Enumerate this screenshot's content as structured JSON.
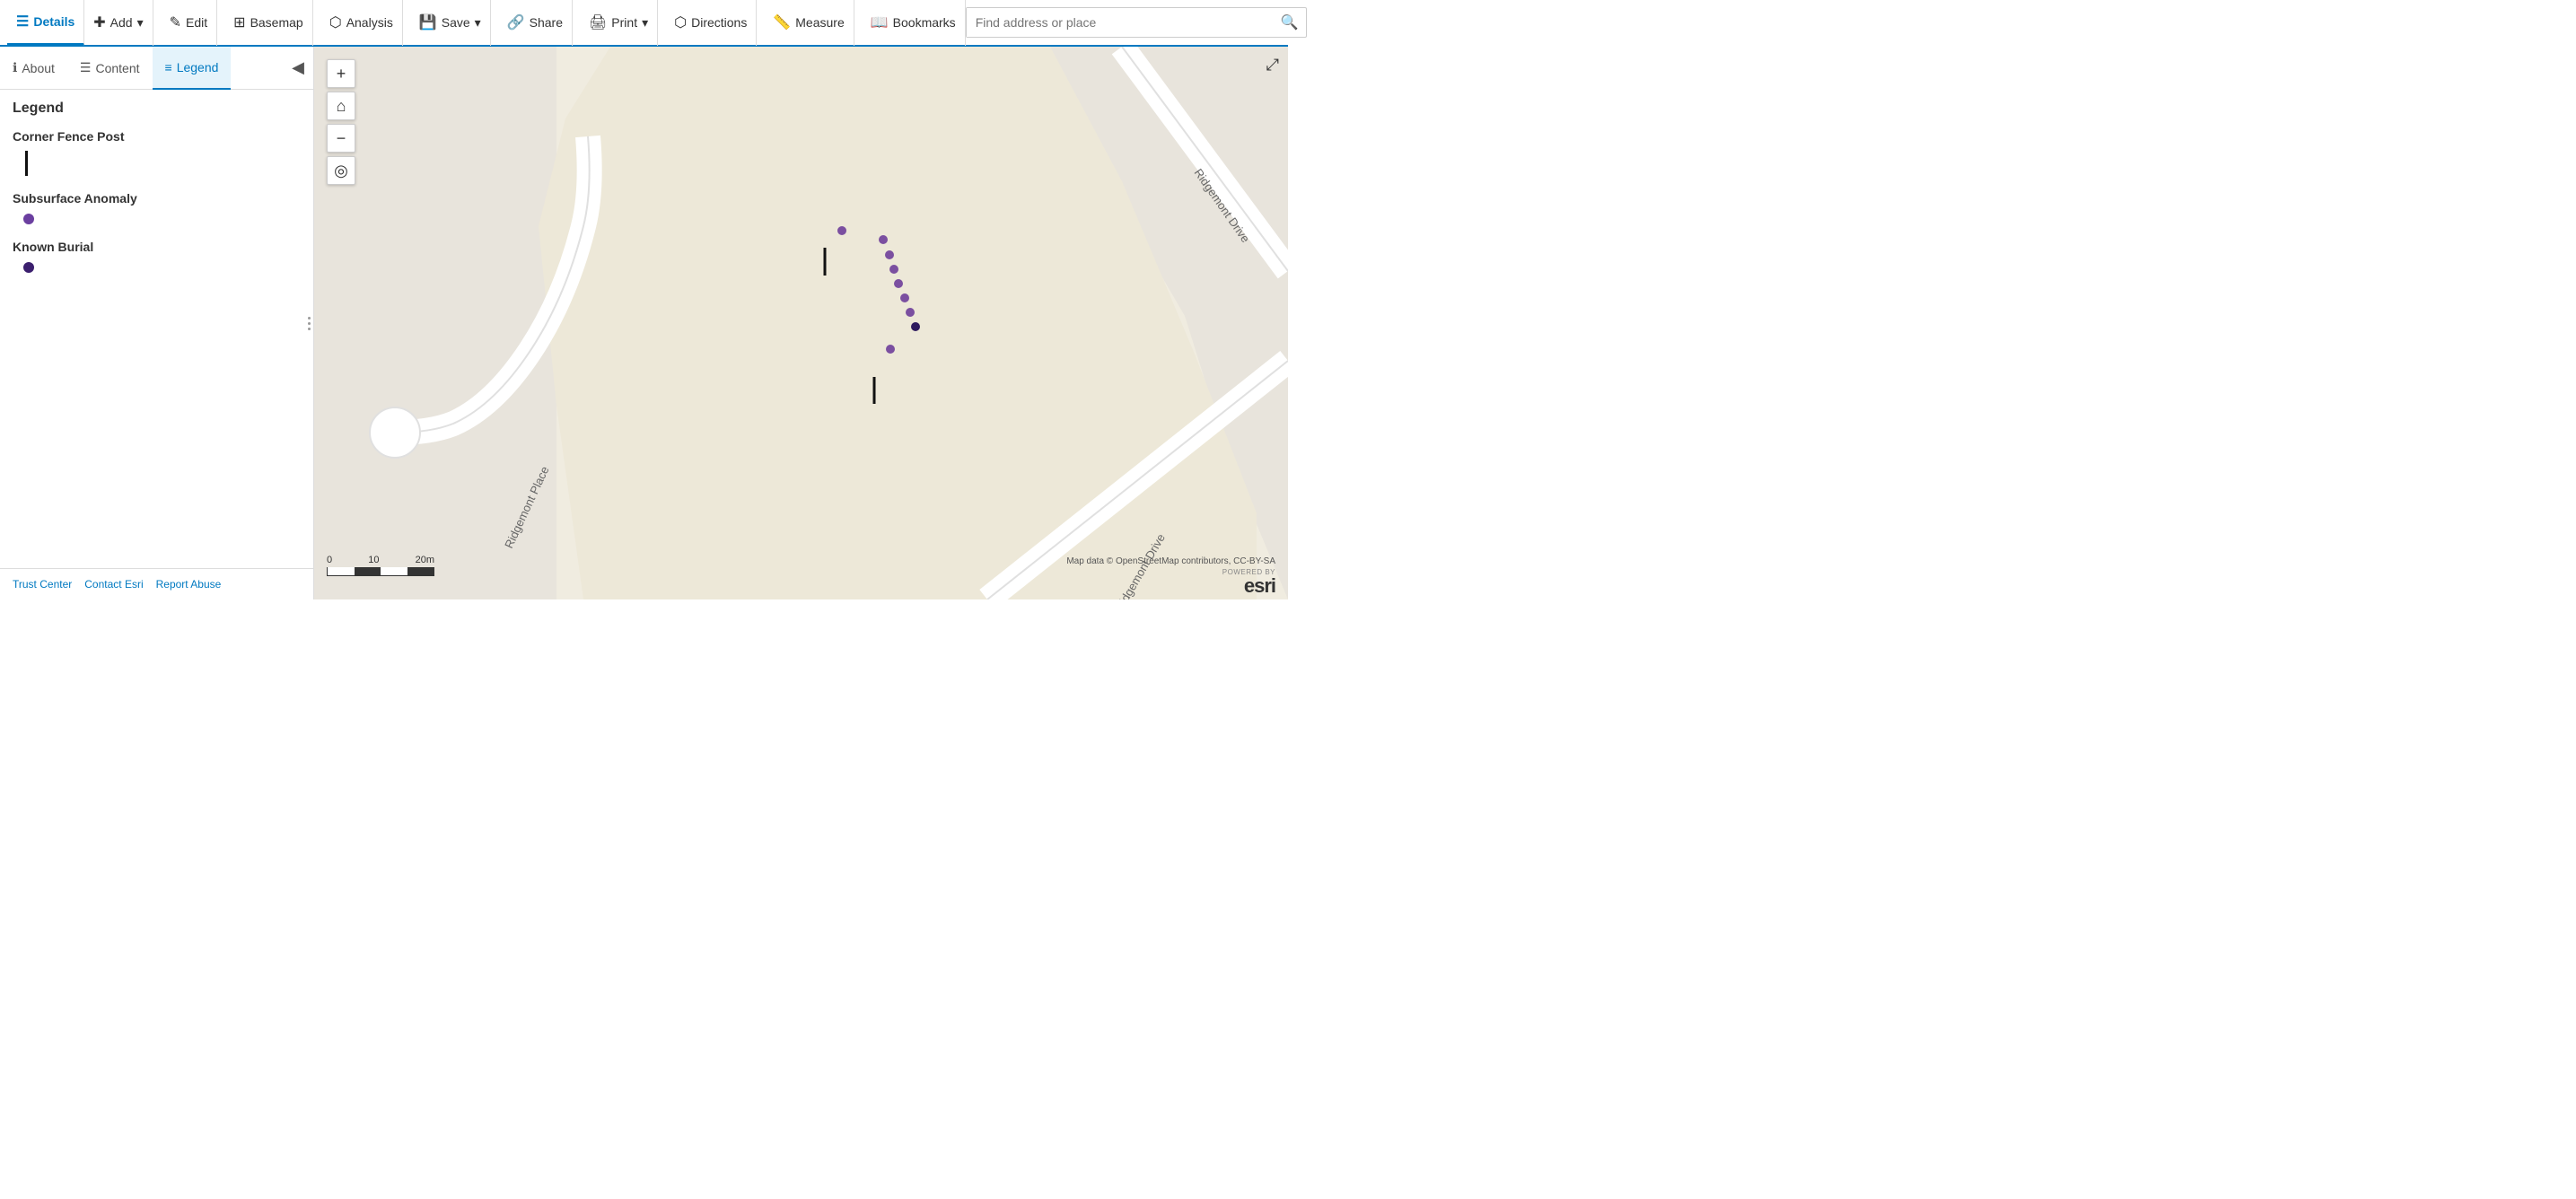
{
  "toolbar": {
    "details_label": "Details",
    "add_label": "Add",
    "edit_label": "Edit",
    "basemap_label": "Basemap",
    "analysis_label": "Analysis",
    "save_label": "Save",
    "share_label": "Share",
    "print_label": "Print",
    "directions_label": "Directions",
    "measure_label": "Measure",
    "bookmarks_label": "Bookmarks",
    "search_placeholder": "Find address or place"
  },
  "sidebar": {
    "about_tab": "About",
    "content_tab": "Content",
    "legend_tab": "Legend",
    "legend_title": "Legend",
    "layers": [
      {
        "name": "Corner Fence Post",
        "symbol_type": "line"
      },
      {
        "name": "Subsurface Anomaly",
        "symbol_type": "dot_purple"
      },
      {
        "name": "Known Burial",
        "symbol_type": "dot_dark"
      }
    ],
    "footer": {
      "trust_center": "Trust Center",
      "contact_esri": "Contact Esri",
      "report_abuse": "Report Abuse"
    }
  },
  "map": {
    "attribution": "Map data © OpenStreetMap contributors, CC-BY-SA",
    "powered_by": "POWERED BY",
    "esri": "esri",
    "scale_labels": [
      "0",
      "10",
      "20m"
    ],
    "road_labels": [
      "Ridgemont Drive",
      "Ridgemont Place",
      "Ridgemont Drive"
    ]
  },
  "icons": {
    "details": "☰",
    "add": "✚",
    "edit": "✎",
    "basemap": "⊞",
    "analysis": "⬡",
    "save": "💾",
    "share": "🔗",
    "print": "🖨",
    "directions": "⬡",
    "measure": "📏",
    "bookmarks": "📖",
    "search": "🔍",
    "zoom_in": "+",
    "zoom_out": "−",
    "home": "⌂",
    "locate": "◎",
    "expand": "⤢",
    "collapse": "◀"
  }
}
